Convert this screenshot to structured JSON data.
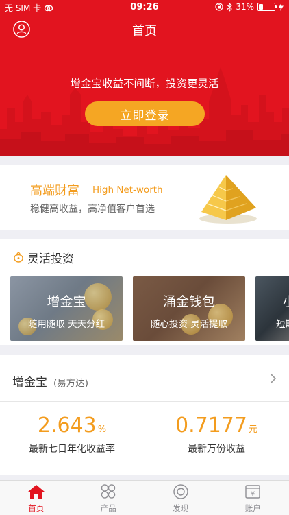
{
  "status_bar": {
    "carrier": "无 SIM 卡",
    "time": "09:26",
    "battery_percent": "31%",
    "battery_level": 0.31
  },
  "nav": {
    "title": "首页"
  },
  "hero": {
    "slogan": "增金宝收益不间断，投资更灵活",
    "login_label": "立即登录"
  },
  "high_net_worth": {
    "title": "高端财富",
    "title_en": "High Net-worth",
    "subtitle": "稳健高收益，高净值客户首选"
  },
  "flexible": {
    "title": "灵活投资",
    "cards": [
      {
        "title": "增金宝",
        "subtitle": "随用随取 天天分红"
      },
      {
        "title": "涌金钱包",
        "subtitle": "随心投资 灵活提取"
      },
      {
        "title": "小",
        "subtitle": "短期"
      }
    ]
  },
  "zengjinbao": {
    "name": "增金宝",
    "fund": "(易方达)",
    "metrics": [
      {
        "value": "2.643",
        "unit": "%",
        "label": "最新七日年化收益率"
      },
      {
        "value": "0.7177",
        "unit": "元",
        "label": "最新万份收益"
      }
    ]
  },
  "tabs": [
    {
      "label": "首页",
      "icon": "home-icon",
      "active": true
    },
    {
      "label": "产品",
      "icon": "grid-icon",
      "active": false
    },
    {
      "label": "发现",
      "icon": "discover-icon",
      "active": false
    },
    {
      "label": "账户",
      "icon": "account-icon",
      "active": false
    }
  ],
  "colors": {
    "brand_red": "#e2141f",
    "accent_orange": "#f5a623",
    "value_orange": "#f39c1e"
  }
}
